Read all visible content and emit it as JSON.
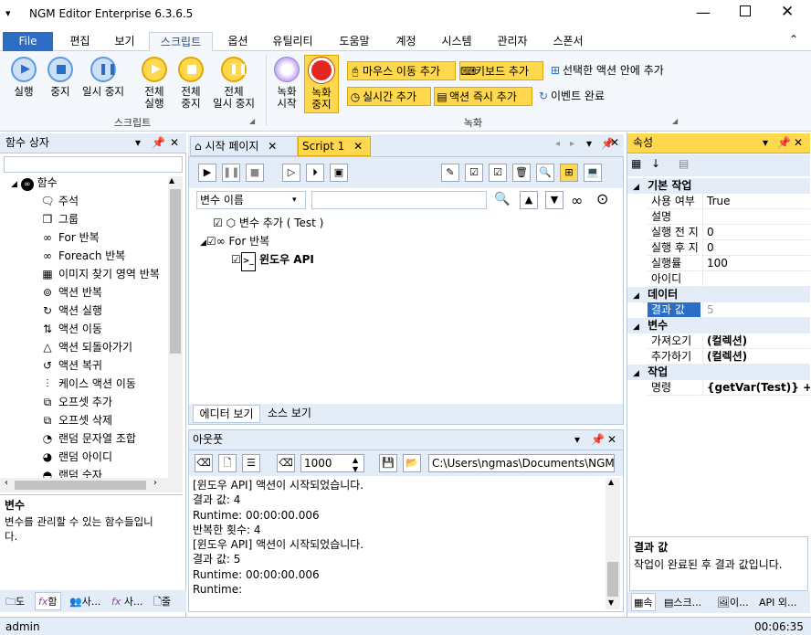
{
  "window": {
    "title": "NGM Editor  Enterprise 6.3.6.5"
  },
  "menu": {
    "file": "File",
    "tabs": [
      "편집",
      "보기",
      "스크립트",
      "옵션",
      "유틸리티",
      "도움말",
      "계정",
      "시스템",
      "관리자",
      "스폰서"
    ]
  },
  "ribbon": {
    "run": "실행",
    "stop": "중지",
    "pause": "일시 중지",
    "all_run": "전체\n실행",
    "all_stop": "전체\n중지",
    "all_pause": "전체\n일시 중지",
    "script_group": "스크립트",
    "rec_start": "녹화\n시작",
    "rec_stop": "녹화\n중지",
    "mouse_move": "마우스 이동 추가",
    "keyboard": "키보드 추가",
    "in_selected": "선택한 액션 안에 추가",
    "realtime": "실시간 추가",
    "action_immediate": "액션 즉시 추가",
    "event_done": "이벤트 완료",
    "record_group": "녹화"
  },
  "left_panel": {
    "title": "함수 상자",
    "root": "함수",
    "items": [
      {
        "icon": "comment-icon",
        "label": "주석"
      },
      {
        "icon": "group-icon",
        "label": "그룹"
      },
      {
        "icon": "infinity-icon",
        "label": "For 반복"
      },
      {
        "icon": "infinity-icon",
        "label": "Foreach 반복"
      },
      {
        "icon": "image-search-icon",
        "label": "이미지 찾기 영역 반복"
      },
      {
        "icon": "loop-icon",
        "label": "액션 반복"
      },
      {
        "icon": "run-action-icon",
        "label": "액션 실행"
      },
      {
        "icon": "move-action-icon",
        "label": "액션 이동"
      },
      {
        "icon": "rollback-icon",
        "label": "액션 되돌아가기"
      },
      {
        "icon": "restore-icon",
        "label": "액션 복귀"
      },
      {
        "icon": "case-move-icon",
        "label": "케이스 액션 이동"
      },
      {
        "icon": "offset-add-icon",
        "label": "오프셋 추가"
      },
      {
        "icon": "offset-delete-icon",
        "label": "오프셋 삭제"
      },
      {
        "icon": "random-string-icon",
        "label": "랜덤 문자열 조합"
      },
      {
        "icon": "random-id-icon",
        "label": "랜덤 아이디"
      },
      {
        "icon": "random-number-icon",
        "label": "랜덤 숫자"
      }
    ],
    "desc_title": "변수",
    "desc_text": "변수를 관리할 수 있는 함수들입니\n다.",
    "bottom_tabs": [
      "도",
      "함",
      "사...",
      "사...",
      "줄"
    ]
  },
  "doc_tabs": [
    "시작 페이지",
    "Script 1"
  ],
  "editor": {
    "var_select": "변수 이름",
    "search_value": "",
    "tree": [
      {
        "label": "변수 추가 ( Test )",
        "bold": false
      },
      {
        "label": "For 반복",
        "bold": false
      },
      {
        "label": "윈도우 API",
        "bold": true
      }
    ],
    "view_tabs": [
      "에디터 보기",
      "소스 보기"
    ]
  },
  "output": {
    "title": "아웃풋",
    "count": "1000",
    "path": "C:\\Users\\ngmas\\Documents\\NGM6\\",
    "lines": [
      "[윈도우 API] 액션이 시작되었습니다.",
      "결과 값: 4",
      "Runtime: 00:00:00.006",
      "반복한 횟수: 4",
      "[윈도우 API] 액션이 시작되었습니다.",
      "결과 값: 5",
      "Runtime: 00:00:00.006",
      "Runtime:"
    ]
  },
  "properties": {
    "title": "속성",
    "sections": [
      {
        "name": "기본 작업",
        "rows": [
          [
            "사용 여부",
            "True"
          ],
          [
            "설명",
            ""
          ],
          [
            "실행 전 지",
            "0"
          ],
          [
            "실행 후 지",
            "0"
          ],
          [
            "실행률",
            "100"
          ],
          [
            "아이디",
            ""
          ]
        ]
      },
      {
        "name": "데이터",
        "rows": [
          [
            "결과 값",
            "5"
          ]
        ]
      },
      {
        "name": "변수",
        "rows": [
          [
            "가져오기",
            "(컬렉션)"
          ],
          [
            "추가하기",
            "(컬렉션)"
          ]
        ]
      },
      {
        "name": "작업",
        "rows": [
          [
            "명령",
            "{getVar(Test)} +"
          ]
        ]
      }
    ],
    "desc_title": "결과 값",
    "desc_text": "작업이 완료된 후 결과 값입니다.",
    "bottom_tabs": [
      "속",
      "스크...",
      "이...",
      "외..."
    ]
  },
  "status": {
    "user": "admin",
    "time": "00:06:35"
  },
  "colors": {
    "accent": "#2b6cc4",
    "highlight": "#ffd84d",
    "panel": "#e4ecf7"
  }
}
